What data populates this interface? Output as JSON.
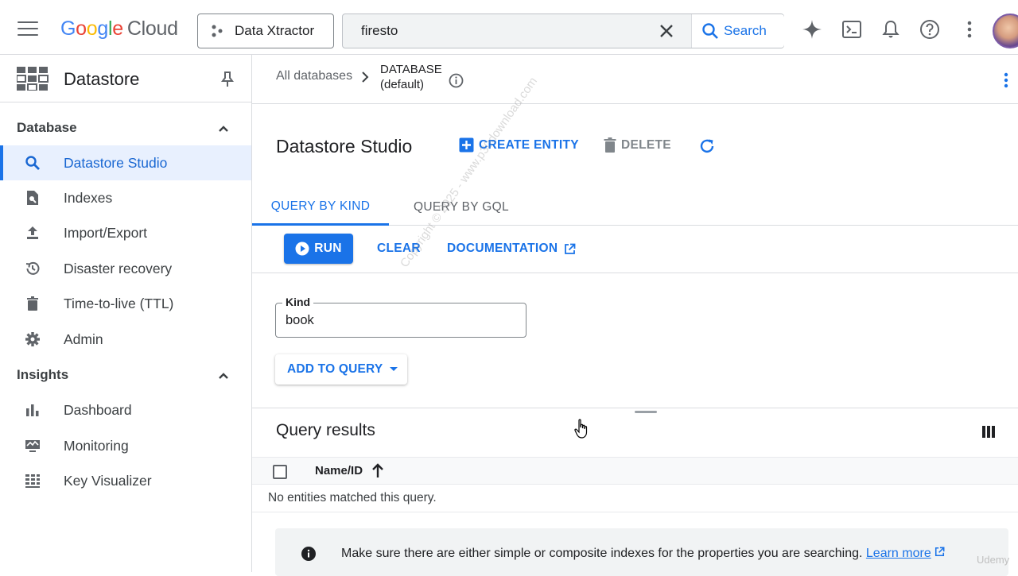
{
  "topbar": {
    "logo": {
      "g": "G",
      "o1": "o",
      "o2": "o",
      "g2": "g",
      "l": "l",
      "e": "e",
      "cloud": "Cloud"
    },
    "project": "Data Xtractor",
    "search_value": "firesto",
    "search_button": "Search",
    "icons": [
      "menu-icon",
      "clear-icon",
      "search-icon",
      "gemini-icon",
      "terminal-icon",
      "bell-icon",
      "help-icon",
      "more-vert-icon"
    ]
  },
  "sidebar": {
    "title": "Datastore",
    "sections": [
      {
        "label": "Database"
      },
      {
        "label": "Insights"
      }
    ],
    "items": [
      {
        "label": "Datastore Studio",
        "icon": "search-icon",
        "active": true
      },
      {
        "label": "Indexes",
        "icon": "indexes-icon"
      },
      {
        "label": "Import/Export",
        "icon": "upload-icon"
      },
      {
        "label": "Disaster recovery",
        "icon": "history-icon"
      },
      {
        "label": "Time-to-live (TTL)",
        "icon": "trash-icon"
      },
      {
        "label": "Admin",
        "icon": "gear-icon"
      },
      {
        "label": "Dashboard",
        "icon": "bar-chart-icon"
      },
      {
        "label": "Monitoring",
        "icon": "monitoring-icon"
      },
      {
        "label": "Key Visualizer",
        "icon": "key-visualizer-icon"
      }
    ]
  },
  "breadcrumb": {
    "root": "All databases",
    "current_line1": "DATABASE",
    "current_line2": "(default)"
  },
  "page": {
    "title": "Datastore Studio",
    "create_entity": "CREATE ENTITY",
    "delete": "DELETE"
  },
  "tabs": [
    {
      "label": "QUERY BY KIND",
      "active": true
    },
    {
      "label": "QUERY BY GQL",
      "active": false
    }
  ],
  "toolbar": {
    "run": "RUN",
    "clear": "CLEAR",
    "documentation": "DOCUMENTATION"
  },
  "kind_field": {
    "label": "Kind",
    "value": "book"
  },
  "add_to_query": "ADD TO QUERY",
  "results": {
    "title": "Query results",
    "column": "Name/ID",
    "empty": "No entities matched this query."
  },
  "notice": {
    "text": "Make sure there are either simple or composite indexes for the properties you are searching.",
    "link": "Learn more"
  },
  "watermark": "Copyright © 2025 - www.p30download.com",
  "udemy": "Udemy",
  "colors": {
    "accent": "#1a73e8",
    "active_bg": "#e8f0fe"
  }
}
